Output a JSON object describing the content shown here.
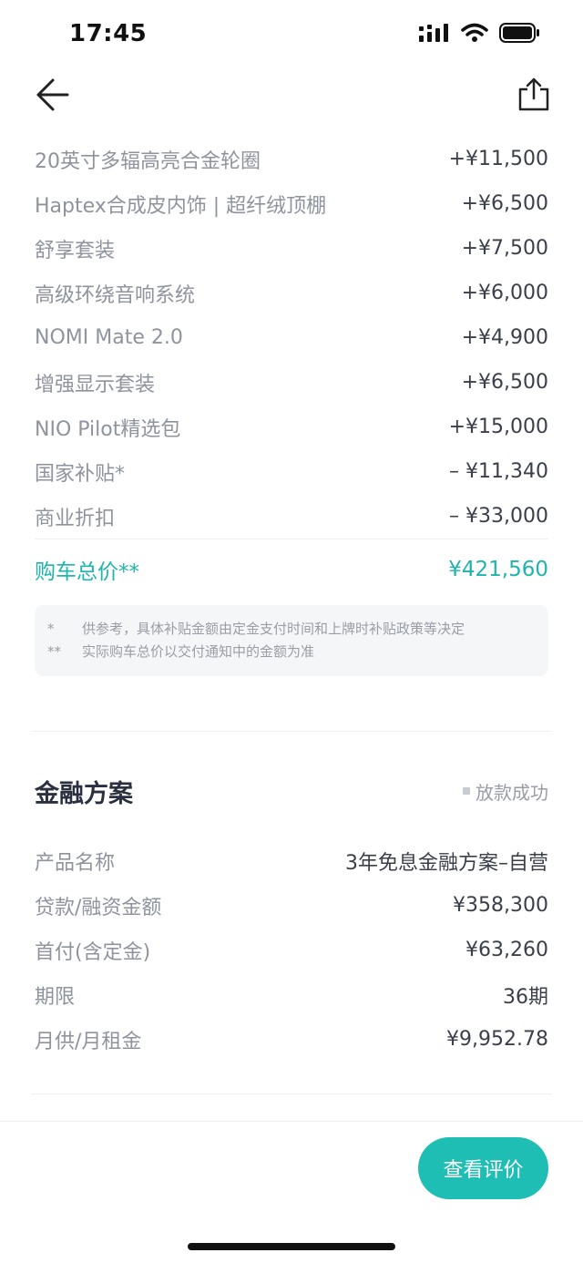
{
  "status_bar": {
    "time": "17:45"
  },
  "price_items": [
    {
      "label": "20英寸多辐高亮合金轮圈",
      "value": "+¥11,500"
    },
    {
      "label": "Haptex合成皮内饰 | 超纤绒顶棚",
      "value": "+¥6,500"
    },
    {
      "label": "舒享套装",
      "value": "+¥7,500"
    },
    {
      "label": "高级环绕音响系统",
      "value": "+¥6,000"
    },
    {
      "label": "NOMI Mate 2.0",
      "value": "+¥4,900"
    },
    {
      "label": "增强显示套装",
      "value": "+¥6,500"
    },
    {
      "label": "NIO Pilot精选包",
      "value": "+¥15,000"
    },
    {
      "label": "国家补贴*",
      "value": "– ¥11,340"
    },
    {
      "label": "商业折扣",
      "value": "– ¥33,000"
    }
  ],
  "total": {
    "label": "购车总价**",
    "value": "¥421,560"
  },
  "notes": [
    {
      "mark": "*",
      "text": "供参考，具体补贴金额由定金支付时间和上牌时补贴政策等决定"
    },
    {
      "mark": "**",
      "text": "实际购车总价以交付通知中的金额为准"
    }
  ],
  "finance": {
    "title": "金融方案",
    "status": "放款成功",
    "rows": [
      {
        "label": "产品名称",
        "value": "3年免息金融方案–自营"
      },
      {
        "label": "贷款/融资金额",
        "value": "¥358,300"
      },
      {
        "label": "首付(含定金)",
        "value": "¥63,260"
      },
      {
        "label": "期限",
        "value": "36期"
      },
      {
        "label": "月供/月租金",
        "value": "¥9,952.78"
      }
    ]
  },
  "bottom": {
    "review_button": "查看评价"
  },
  "colors": {
    "accent": "#1fbeb5",
    "total_text": "#1fb5ad"
  }
}
